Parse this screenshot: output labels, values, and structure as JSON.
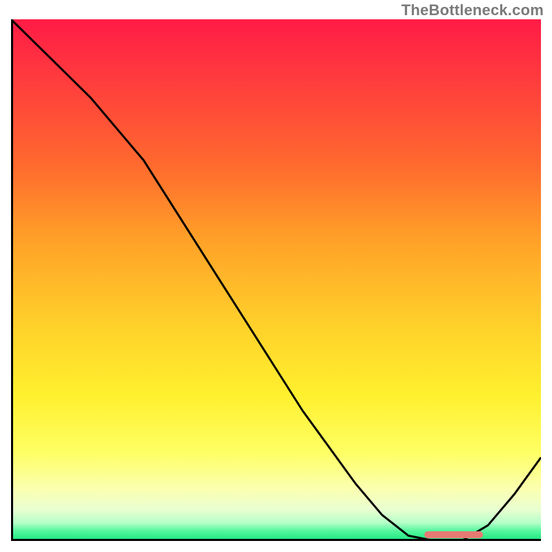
{
  "attribution": "TheBottleneck.com",
  "colors": {
    "gradient_top": "#ff1b46",
    "gradient_bottom": "#18e67c",
    "curve": "#000000",
    "axes": "#000000",
    "trough_marker": "#e77a73"
  },
  "chart_data": {
    "type": "line",
    "title": "",
    "xlabel": "",
    "ylabel": "",
    "xlim": [
      0,
      100
    ],
    "ylim": [
      0,
      100
    ],
    "x": [
      0,
      5,
      10,
      15,
      20,
      25,
      30,
      35,
      40,
      45,
      50,
      55,
      60,
      65,
      70,
      75,
      80,
      85,
      90,
      95,
      100
    ],
    "values": [
      100,
      95,
      90,
      85,
      79,
      73,
      65,
      57,
      49,
      41,
      33,
      25,
      18,
      11,
      5,
      1,
      0,
      0,
      3,
      9,
      16
    ],
    "trough_range_x": [
      78,
      89
    ],
    "annotations": []
  }
}
